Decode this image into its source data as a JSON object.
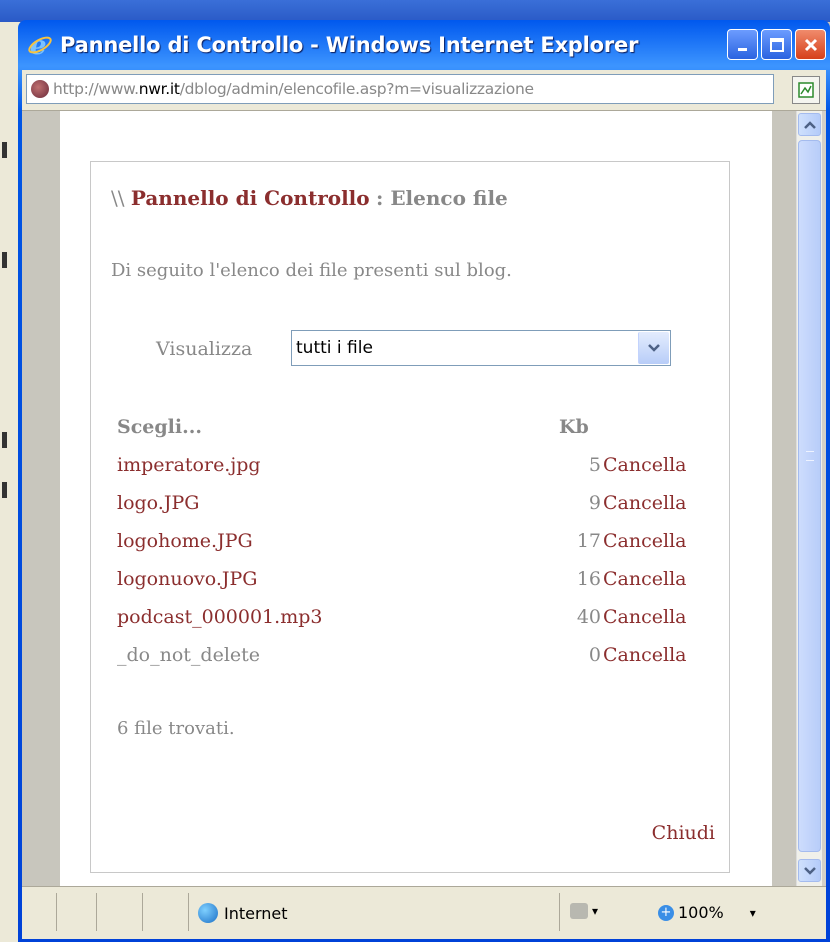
{
  "window": {
    "title": "Pannello di Controllo - Windows Internet Explorer"
  },
  "address": {
    "url_prefix": "http://www.",
    "url_domain": "nwr.it",
    "url_path": "/dblog/admin/elencofile.asp?m=visualizzazione"
  },
  "panel": {
    "heading_prefix": "\\\\",
    "heading_brand": "Pannello di Controllo",
    "heading_sub": ": Elenco file",
    "intro": "Di seguito l'elenco dei file presenti sul blog.",
    "filter_label": "Visualizza",
    "filter_value": "tutti i file",
    "col_name": "Scegli...",
    "col_kb": "Kb",
    "files": [
      {
        "name": "imperatore.jpg",
        "kb": "5",
        "action": "Cancella"
      },
      {
        "name": "logo.JPG",
        "kb": "9",
        "action": "Cancella"
      },
      {
        "name": "logohome.JPG",
        "kb": "17",
        "action": "Cancella"
      },
      {
        "name": "logonuovo.JPG",
        "kb": "16",
        "action": "Cancella"
      },
      {
        "name": "podcast_000001.mp3",
        "kb": "40",
        "action": "Cancella"
      },
      {
        "name": "_do_not_delete",
        "kb": "0",
        "action": "Cancella"
      }
    ],
    "found_text": "6 file trovati.",
    "close_label": "Chiudi"
  },
  "status": {
    "zone": "Internet",
    "zoom": "100%"
  },
  "colors": {
    "link": "#8b2e2e",
    "muted": "#888888",
    "titlebar": "#0055e5"
  }
}
